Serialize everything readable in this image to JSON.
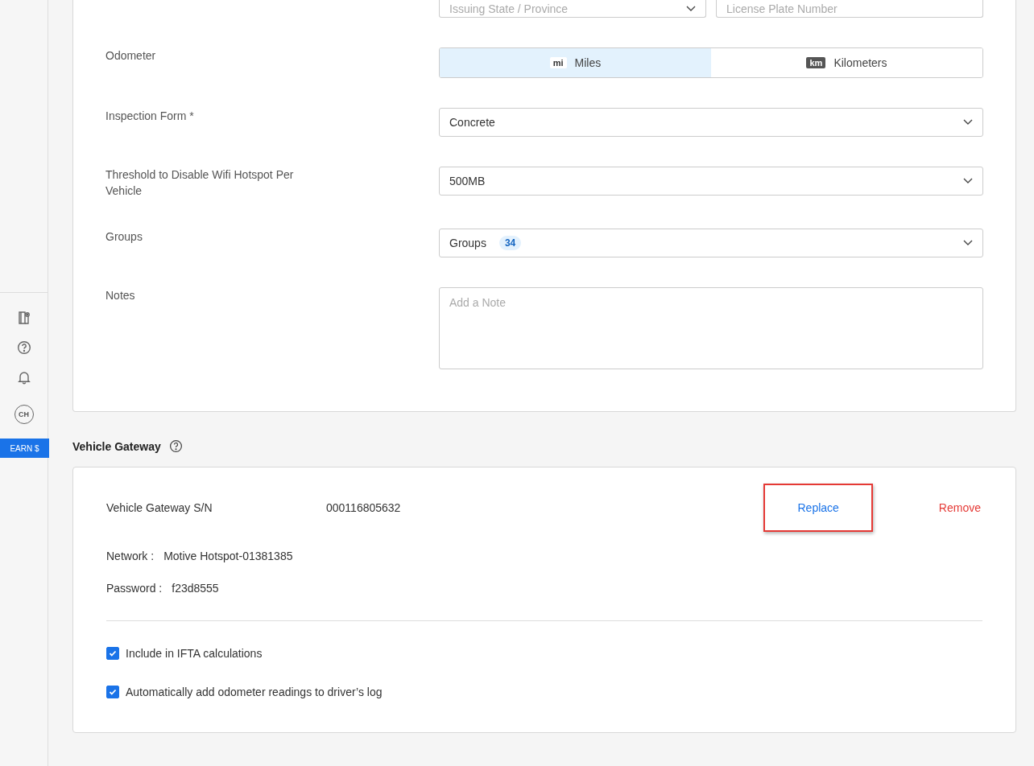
{
  "sidebar": {
    "avatar": "CH",
    "earn_button": "EARN $"
  },
  "vehicle_form": {
    "rows": [
      {
        "kind": "pair",
        "label": "",
        "fields": [
          {
            "placeholder": "Issuing State / Province",
            "dropdown": true
          },
          {
            "placeholder": "License Plate Number",
            "dropdown": false
          }
        ]
      },
      {
        "kind": "toggle",
        "label": "Odometer",
        "options": [
          {
            "badge": "mi",
            "label": "Miles",
            "selected": true
          },
          {
            "badge": "km",
            "label": "Kilometers",
            "selected": false
          }
        ]
      },
      {
        "kind": "select",
        "label": "Inspection Form *",
        "value": "Concrete"
      },
      {
        "kind": "select",
        "label": "Threshold to Disable Wifi Hotspot Per Vehicle",
        "value": "500MB"
      },
      {
        "kind": "groups",
        "label": "Groups",
        "value": "Groups",
        "count": "34"
      },
      {
        "kind": "textarea",
        "label": "Notes",
        "placeholder": "Add a Note"
      }
    ]
  },
  "vehicle_gateway": {
    "title": "Vehicle Gateway",
    "serial_label": "Vehicle Gateway S/N",
    "serial": "000116805632",
    "actions": [
      {
        "label": "Replace",
        "kind": "link",
        "highlighted": true
      },
      {
        "label": "Remove",
        "kind": "danger",
        "highlighted": false
      }
    ],
    "details": [
      {
        "label": "Network :",
        "value": "Motive Hotspot-01381385"
      },
      {
        "label": "Password :",
        "value": "f23d8555"
      }
    ],
    "checkboxes": [
      {
        "label": "Include in IFTA calculations",
        "checked": true
      },
      {
        "label": "Automatically add odometer readings to driver’s log",
        "checked": true
      }
    ]
  }
}
